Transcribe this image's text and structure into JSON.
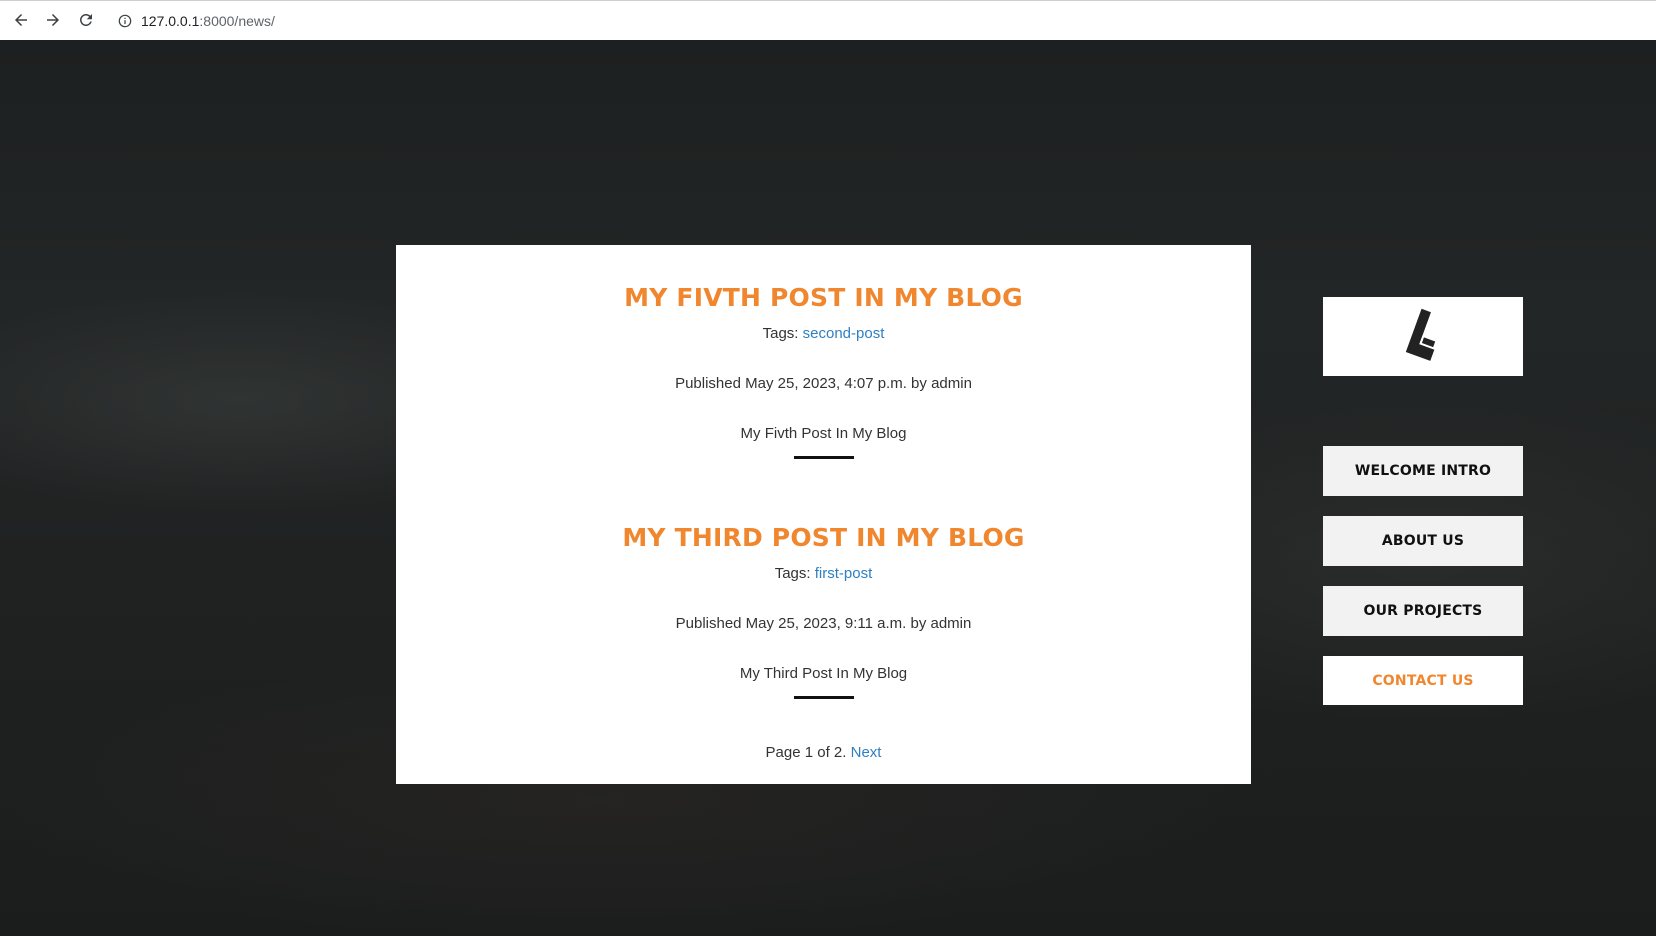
{
  "browser": {
    "url_host": "127.0.0.1",
    "url_rest": ":8000/news/"
  },
  "posts": [
    {
      "title": "MY FIVTH POST IN MY BLOG",
      "tags_label": "Tags:",
      "tag": "second-post",
      "published": "Published May 25, 2023, 4:07 p.m. by admin",
      "body": "My Fivth Post In My Blog"
    },
    {
      "title": "MY THIRD POST IN MY BLOG",
      "tags_label": "Tags:",
      "tag": "first-post",
      "published": "Published May 25, 2023, 9:11 a.m. by admin",
      "body": "My Third Post In My Blog"
    }
  ],
  "pagination": {
    "text": "Page 1 of 2.",
    "next_label": "Next"
  },
  "sidebar": {
    "logo_icon": "logo-icon",
    "items": [
      {
        "label": "WELCOME INTRO"
      },
      {
        "label": "ABOUT US"
      },
      {
        "label": "OUR PROJECTS"
      },
      {
        "label": "CONTACT US"
      }
    ]
  },
  "colors": {
    "accent": "#f0872e",
    "link": "#2f7fc1",
    "background": "#1f2222"
  }
}
